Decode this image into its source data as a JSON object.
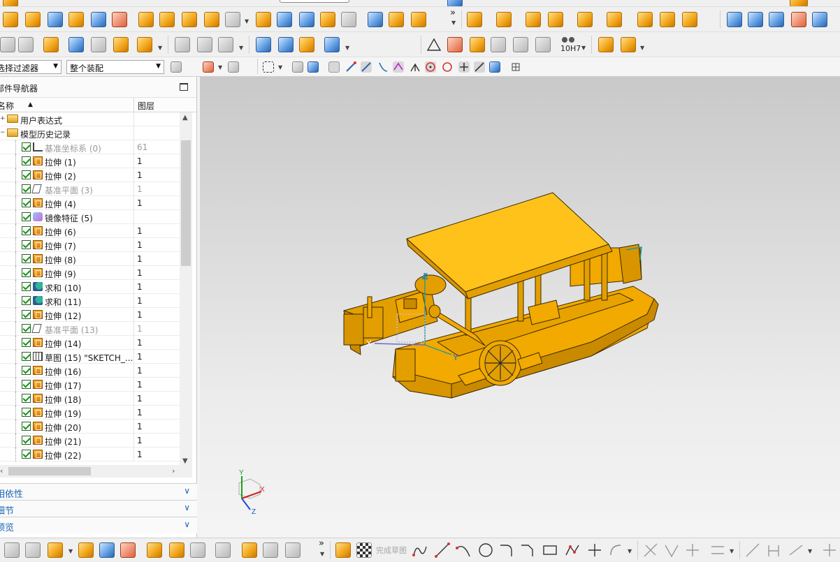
{
  "toolbars": {
    "filter_combo": "选择过滤器",
    "assembly_combo": "整个装配",
    "tol_label": "10H7",
    "finish_sketch": "完成草图",
    "more": "»"
  },
  "navigator": {
    "title": "部件导航器",
    "col_name": "名称",
    "col_layer": "图层",
    "groups": [
      {
        "label": "用户表达式"
      },
      {
        "label": "模型历史记录"
      }
    ],
    "features": [
      {
        "label": "基准坐标系 (0)",
        "layer": "61",
        "icon": "csys",
        "dim": true
      },
      {
        "label": "拉伸 (1)",
        "layer": "1",
        "icon": "ext",
        "dim": false
      },
      {
        "label": "拉伸 (2)",
        "layer": "1",
        "icon": "ext",
        "dim": false
      },
      {
        "label": "基准平面 (3)",
        "layer": "1",
        "icon": "plane",
        "dim": true
      },
      {
        "label": "拉伸 (4)",
        "layer": "1",
        "icon": "ext",
        "dim": false
      },
      {
        "label": "镜像特征 (5)",
        "layer": "",
        "icon": "mirror",
        "dim": false
      },
      {
        "label": "拉伸 (6)",
        "layer": "1",
        "icon": "ext",
        "dim": false
      },
      {
        "label": "拉伸 (7)",
        "layer": "1",
        "icon": "ext",
        "dim": false
      },
      {
        "label": "拉伸 (8)",
        "layer": "1",
        "icon": "ext",
        "dim": false
      },
      {
        "label": "拉伸 (9)",
        "layer": "1",
        "icon": "ext",
        "dim": false
      },
      {
        "label": "求和 (10)",
        "layer": "1",
        "icon": "unite",
        "dim": false
      },
      {
        "label": "求和 (11)",
        "layer": "1",
        "icon": "unite",
        "dim": false
      },
      {
        "label": "拉伸 (12)",
        "layer": "1",
        "icon": "ext",
        "dim": false
      },
      {
        "label": "基准平面 (13)",
        "layer": "1",
        "icon": "plane",
        "dim": true
      },
      {
        "label": "拉伸 (14)",
        "layer": "1",
        "icon": "ext",
        "dim": false
      },
      {
        "label": "草图 (15) \"SKETCH_...",
        "layer": "1",
        "icon": "sketch",
        "dim": false
      },
      {
        "label": "拉伸 (16)",
        "layer": "1",
        "icon": "ext",
        "dim": false
      },
      {
        "label": "拉伸 (17)",
        "layer": "1",
        "icon": "ext",
        "dim": false
      },
      {
        "label": "拉伸 (18)",
        "layer": "1",
        "icon": "ext",
        "dim": false
      },
      {
        "label": "拉伸 (19)",
        "layer": "1",
        "icon": "ext",
        "dim": false
      },
      {
        "label": "拉伸 (20)",
        "layer": "1",
        "icon": "ext",
        "dim": false
      },
      {
        "label": "拉伸 (21)",
        "layer": "1",
        "icon": "ext",
        "dim": false
      },
      {
        "label": "拉伸 (22)",
        "layer": "1",
        "icon": "ext",
        "dim": false
      }
    ],
    "panels": [
      {
        "label": "相依性"
      },
      {
        "label": "细节"
      },
      {
        "label": "预览"
      }
    ]
  },
  "viewport": {
    "axis_x": "X",
    "axis_y": "Y",
    "axis_z": "Z",
    "model_color": "#f2a900",
    "triad_x": "X",
    "triad_y": "Y",
    "triad_z": "Z"
  }
}
